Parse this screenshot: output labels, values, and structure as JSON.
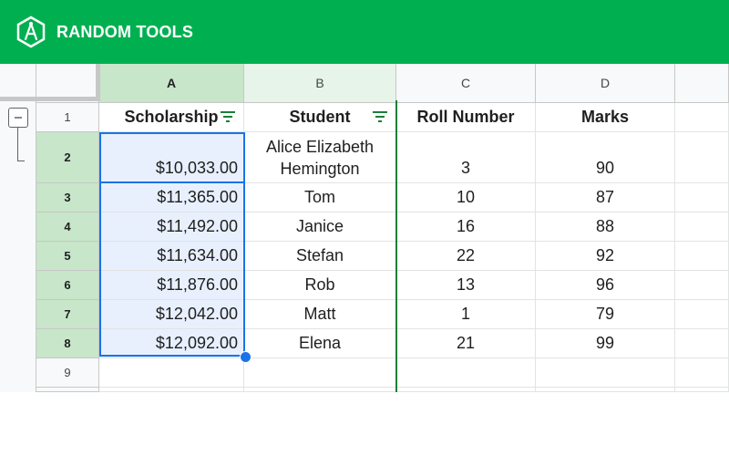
{
  "brand": {
    "name": "RANDOM TOOLS"
  },
  "colors": {
    "banner": "#00b050",
    "selection": "#1a73e8",
    "header_selected": "#c8e6c9",
    "filter_icon": "#188038"
  },
  "columns": [
    "A",
    "B",
    "C",
    "D"
  ],
  "rows": [
    "1",
    "2",
    "3",
    "4",
    "5",
    "6",
    "7",
    "8",
    "9"
  ],
  "headers": {
    "scholarship": "Scholarship",
    "student": "Student",
    "roll": "Roll Number",
    "marks": "Marks"
  },
  "data": [
    {
      "scholarship": "$10,033.00",
      "student": "Alice Elizabeth Hemington",
      "roll": "3",
      "marks": "90"
    },
    {
      "scholarship": "$11,365.00",
      "student": "Tom",
      "roll": "10",
      "marks": "87"
    },
    {
      "scholarship": "$11,492.00",
      "student": "Janice",
      "roll": "16",
      "marks": "88"
    },
    {
      "scholarship": "$11,634.00",
      "student": "Stefan",
      "roll": "22",
      "marks": "92"
    },
    {
      "scholarship": "$11,876.00",
      "student": "Rob",
      "roll": "13",
      "marks": "96"
    },
    {
      "scholarship": "$12,042.00",
      "student": "Matt",
      "roll": "1",
      "marks": "79"
    },
    {
      "scholarship": "$12,092.00",
      "student": "Elena",
      "roll": "21",
      "marks": "99"
    }
  ]
}
